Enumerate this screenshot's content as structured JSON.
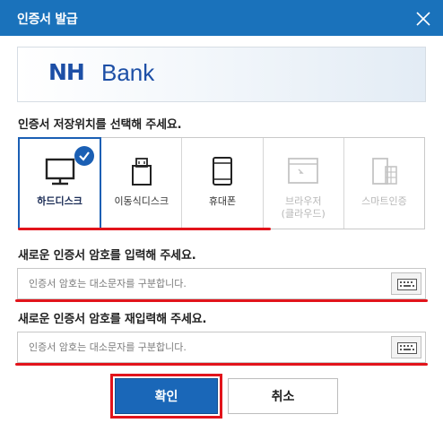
{
  "dialog": {
    "title": "인증서 발급",
    "close_icon": "close-icon"
  },
  "banner": {
    "logo_nh": "NH",
    "logo_bank": "Bank"
  },
  "storage": {
    "label": "인증서 저장위치를 선택해 주세요.",
    "options": [
      {
        "label": "하드디스크",
        "icon": "monitor-icon",
        "selected": true,
        "enabled": true
      },
      {
        "label": "이동식디스크",
        "icon": "usb-drive-icon",
        "selected": false,
        "enabled": true
      },
      {
        "label": "휴대폰",
        "icon": "smartphone-icon",
        "selected": false,
        "enabled": true
      },
      {
        "label": "브라우저\n(클라우드)",
        "icon": "browser-window-icon",
        "selected": false,
        "enabled": false
      },
      {
        "label": "스마트인증",
        "icon": "smart-cert-icon",
        "selected": false,
        "enabled": false
      }
    ],
    "selected_color": "#1a5fb4"
  },
  "password": {
    "label": "새로운 인증서 암호를 입력해 주세요.",
    "placeholder": "인증서 암호는 대소문자를 구분합니다."
  },
  "password_confirm": {
    "label": "새로운 인증서 암호를 재입력해 주세요.",
    "placeholder": "인증서 암호는 대소문자를 구분합니다."
  },
  "buttons": {
    "ok": "확인",
    "cancel": "취소"
  },
  "colors": {
    "titlebar": "#1a72bb",
    "primary_button": "#1a67b8",
    "highlight": "#e2141b"
  }
}
